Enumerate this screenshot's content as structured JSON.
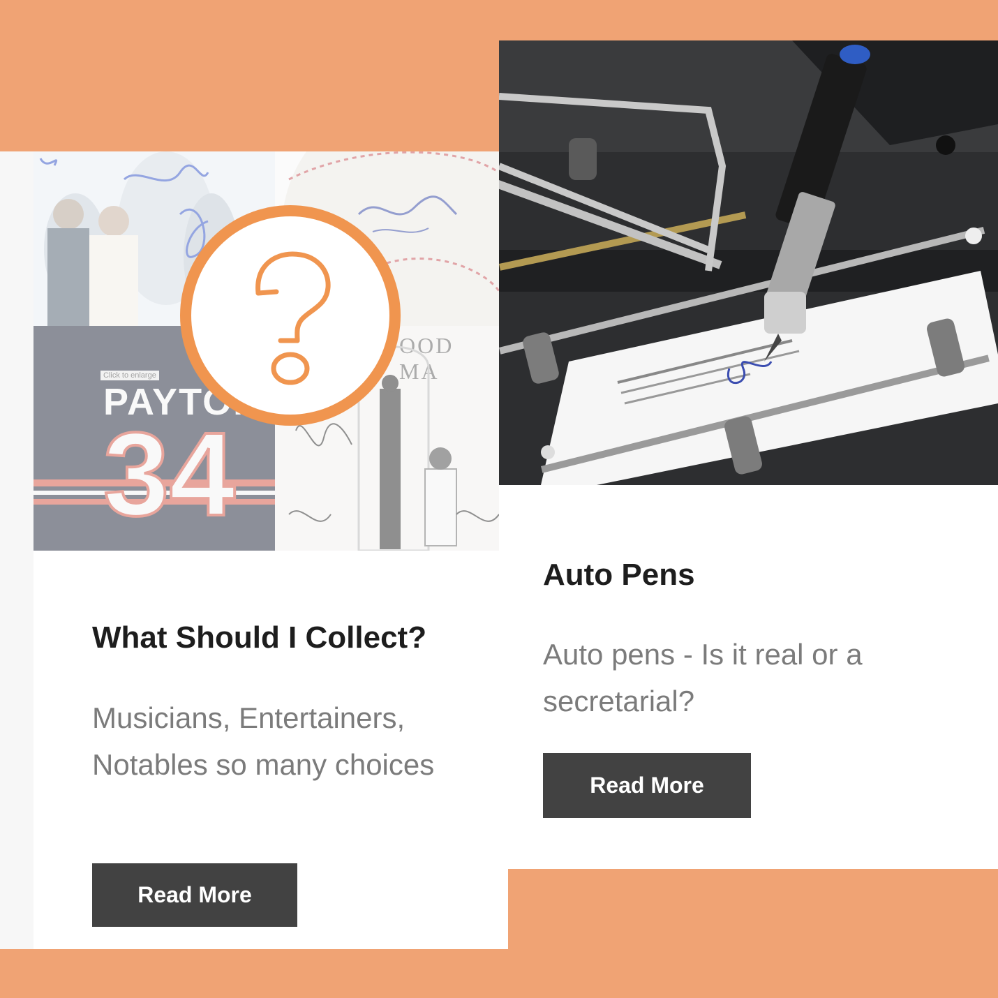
{
  "cards": [
    {
      "title": "What Should I Collect?",
      "description": "Musicians, Entertainers, Notables so many choices",
      "button_label": "Read More",
      "image": {
        "jersey_name": "PAYTON",
        "jersey_number": "34",
        "click_hint": "Click to enlarge",
        "album_text": "OOD MA",
        "icon": "question-mark-icon"
      }
    },
    {
      "title": "Auto Pens",
      "description": "Auto pens - Is it real or a secretarial?",
      "button_label": "Read More",
      "image": {
        "icon": "autopen-machine-photo"
      }
    }
  ],
  "colors": {
    "background": "#f0a374",
    "accent_orange": "#f0954f",
    "button": "#424242",
    "title": "#1d1d1d",
    "description": "#7b7b7b"
  }
}
